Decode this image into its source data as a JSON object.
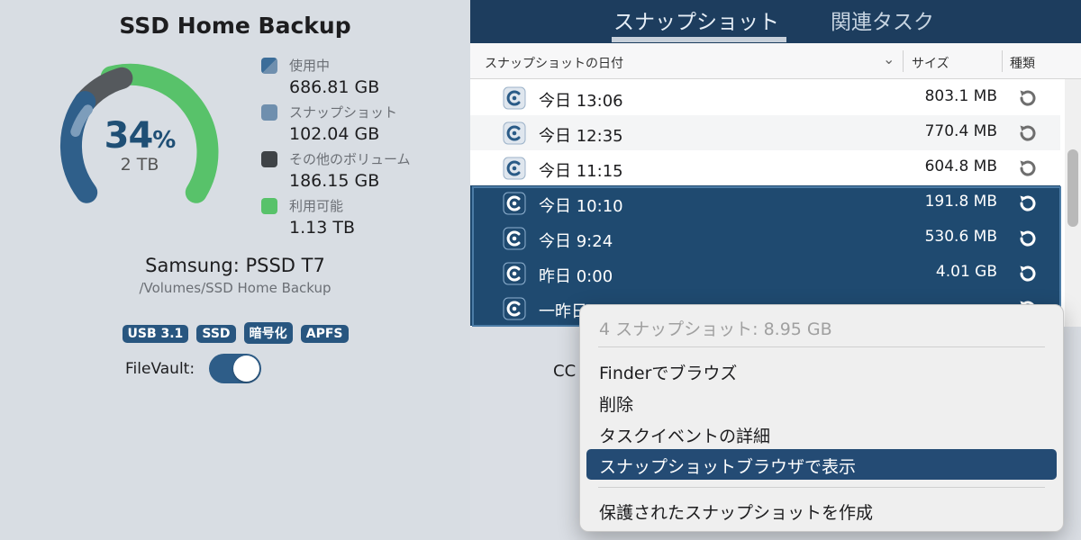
{
  "volume": {
    "title": "SSD Home Backup",
    "percent": "34",
    "percent_sign": "%",
    "capacity": "2 TB",
    "usage_fraction": 0.34,
    "legend": [
      {
        "label": "使用中",
        "value": "686.81 GB",
        "color": "#3c6d99",
        "icon": "used-swatch-icon"
      },
      {
        "label": "スナップショット",
        "value": "102.04 GB",
        "color": "#6f8fae",
        "icon": "snapshot-swatch-icon"
      },
      {
        "label": "その他のボリューム",
        "value": "186.15 GB",
        "color": "#3f4347",
        "icon": "other-volumes-swatch-icon"
      },
      {
        "label": "利用可能",
        "value": "1.13 TB",
        "color": "#58c26a",
        "icon": "available-swatch-icon"
      }
    ],
    "device_name": "Samsung: PSSD T7",
    "path": "/Volumes/SSD Home Backup",
    "badges": [
      "USB 3.1",
      "SSD",
      "暗号化",
      "APFS"
    ],
    "filevault_label": "FileVault:",
    "filevault_on": true
  },
  "tabs": [
    {
      "label": "スナップショット",
      "active": true
    },
    {
      "label": "関連タスク",
      "active": false
    }
  ],
  "table": {
    "headers": {
      "date": "スナップショットの日付",
      "size": "サイズ",
      "type": "種類"
    },
    "rows": [
      {
        "date": "今日 13:06",
        "size": "803.1 MB",
        "selected": false
      },
      {
        "date": "今日 12:35",
        "size": "770.4 MB",
        "selected": false
      },
      {
        "date": "今日 11:15",
        "size": "604.8 MB",
        "selected": false
      },
      {
        "date": "今日 10:10",
        "size": "191.8 MB",
        "selected": true
      },
      {
        "date": "今日 9:24",
        "size": "530.6 MB",
        "selected": true
      },
      {
        "date": "昨日 0:00",
        "size": "4.01 GB",
        "selected": true
      },
      {
        "date": "一昨日",
        "size": "",
        "selected": true
      }
    ]
  },
  "below_text": "CC",
  "context_menu": {
    "header": "4 スナップショット: 8.95 GB",
    "items": [
      "Finderでブラウズ",
      "削除",
      "タスクイベントの詳細",
      "スナップショットブラウザで表示",
      "保護されたスナップショットを作成"
    ],
    "highlighted_index": 3
  },
  "colors": {
    "accent": "#1f4a70",
    "tabbar": "#1d3d5e",
    "gauge_used": "#2f5f8a",
    "gauge_snapshot": "#7d9dbb",
    "gauge_other": "#55595d",
    "gauge_free": "#58c26a"
  }
}
